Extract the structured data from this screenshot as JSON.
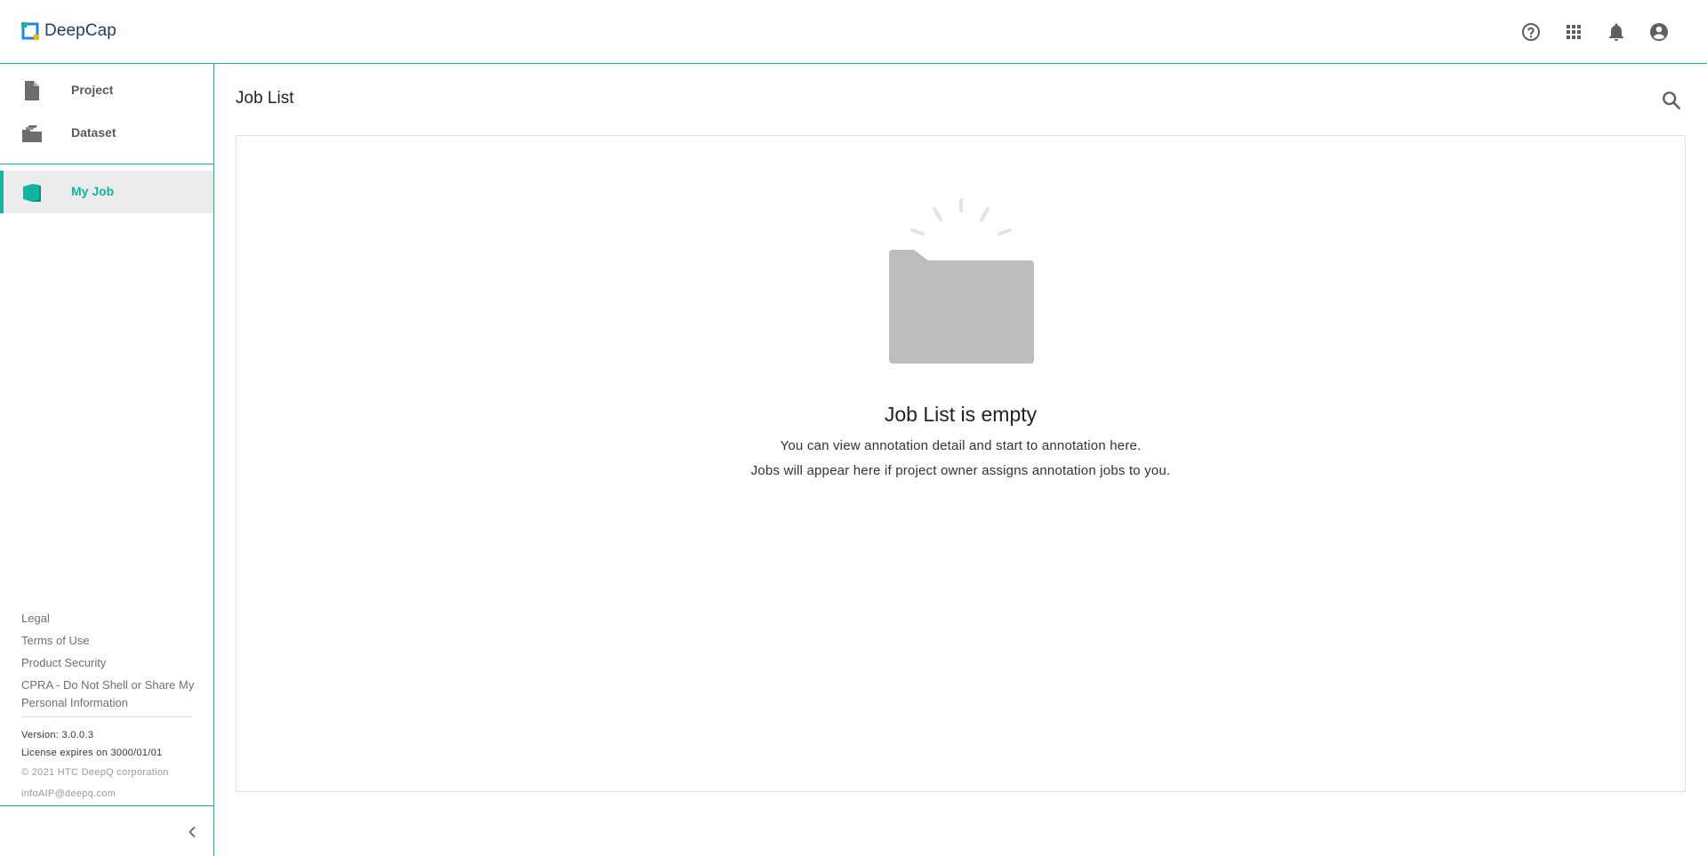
{
  "app": {
    "name": "DeepCap",
    "accent": "#14b3a0"
  },
  "header": {
    "icons": [
      "help-icon",
      "apps-grid-icon",
      "bell-icon",
      "account-icon"
    ]
  },
  "sidebar": {
    "items": [
      {
        "label": "Project",
        "icon": "file-icon"
      },
      {
        "label": "Dataset",
        "icon": "dataset-folder-icon"
      },
      {
        "label": "My Job",
        "icon": "book-icon",
        "active": true
      }
    ],
    "footer": {
      "links": [
        "Legal",
        "Terms of Use",
        "Product Security",
        "CPRA - Do Not Shell or Share My Personal Information"
      ],
      "version": "Version: 3.0.0.3",
      "license": "License expires on 3000/01/01",
      "copyright": "© 2021 HTC DeepQ corporation",
      "email": "infoAIP@deepq.com"
    }
  },
  "main": {
    "title": "Job List",
    "empty_state": {
      "title": "Job List is empty",
      "line1": "You can view annotation detail and start to annotation here.",
      "line2": "Jobs will appear here if project owner assigns annotation jobs to you."
    }
  }
}
